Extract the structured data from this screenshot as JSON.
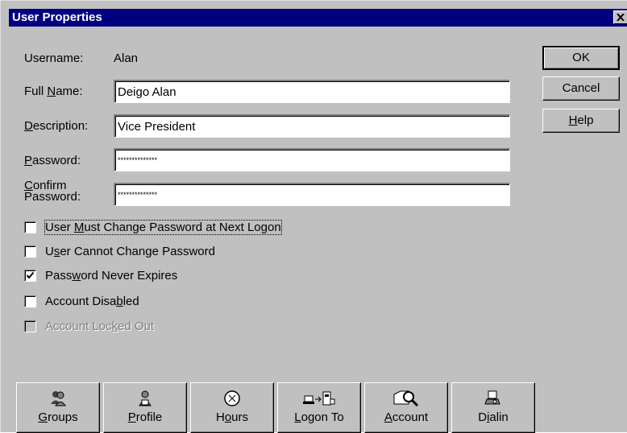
{
  "window": {
    "title": "User Properties"
  },
  "labels": {
    "username": "Username:",
    "full_name": {
      "pre": "Full ",
      "key": "N",
      "post": "ame:"
    },
    "description": {
      "pre": "",
      "key": "D",
      "post": "escription:"
    },
    "password": {
      "pre": "",
      "key": "P",
      "post": "assword:"
    },
    "confirm_line1": {
      "pre": "",
      "key": "C",
      "post": "onfirm"
    },
    "confirm_line2": "Password:"
  },
  "values": {
    "username": "Alan",
    "full_name": "Deigo Alan",
    "description": "Vice President",
    "password": "**************",
    "confirm_password": "**************"
  },
  "checkboxes": [
    {
      "pre": "User ",
      "key": "M",
      "post": "ust Change Password at Next Logon",
      "checked": false,
      "disabled": false
    },
    {
      "pre": "U",
      "key": "s",
      "post": "er Cannot Change Password",
      "checked": false,
      "disabled": false
    },
    {
      "pre": "Pass",
      "key": "w",
      "post": "ord Never Expires",
      "checked": true,
      "disabled": false
    },
    {
      "pre": "Account Disa",
      "key": "b",
      "post": "led",
      "checked": false,
      "disabled": false
    },
    {
      "pre": "Account Loc",
      "key": "k",
      "post": "ed Out",
      "checked": false,
      "disabled": true
    }
  ],
  "side_buttons": {
    "ok": "OK",
    "cancel": "Cancel",
    "help": {
      "pre": "",
      "key": "H",
      "post": "elp"
    }
  },
  "bottom_buttons": [
    {
      "pre": "",
      "key": "G",
      "post": "roups",
      "icon": "groups-icon"
    },
    {
      "pre": "",
      "key": "P",
      "post": "rofile",
      "icon": "profile-icon"
    },
    {
      "pre": "H",
      "key": "o",
      "post": "urs",
      "icon": "hours-icon"
    },
    {
      "pre": "",
      "key": "L",
      "post": "ogon To",
      "icon": "logon-to-icon"
    },
    {
      "pre": "",
      "key": "A",
      "post": "ccount",
      "icon": "account-icon"
    },
    {
      "pre": "D",
      "key": "i",
      "post": "alin",
      "icon": "dialin-icon"
    }
  ]
}
